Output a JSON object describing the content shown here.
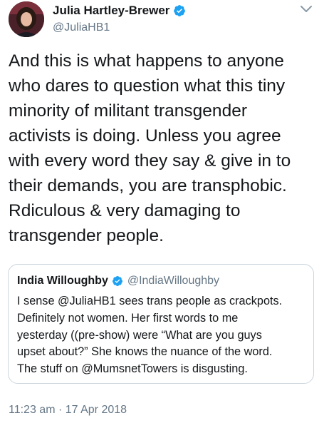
{
  "author": {
    "name": "Julia Hartley-Brewer",
    "handle": "@JuliaHB1"
  },
  "tweet": {
    "text": "And this is what happens to anyone\nwho dares to question what this tiny\nminority of militant transgender\nactivists is doing. Unless you agree\nwith every word they say & give in to\ntheir demands, you are transphobic.\nRdiculous & very damaging to\ntransgender people."
  },
  "quoted": {
    "name": "India Willoughby",
    "handle": "@IndiaWilloughby",
    "text": "I sense @JuliaHB1 sees trans people as crackpots.\nDefinitely not women. Her first words to me\nyesterday ((pre-show) were “What are you guys\nupset about?” She knows the nuance of the word.\nThe stuff on @MumsnetTowers is disgusting."
  },
  "meta": {
    "timestamp": "11:23 am · 17 Apr 2018"
  },
  "icons": {
    "verified": "verified-badge-icon",
    "menu": "chevron-down-icon"
  },
  "colors": {
    "verified": "#1da1f2",
    "secondary_text": "#657786",
    "border": "#ccd6dd"
  }
}
